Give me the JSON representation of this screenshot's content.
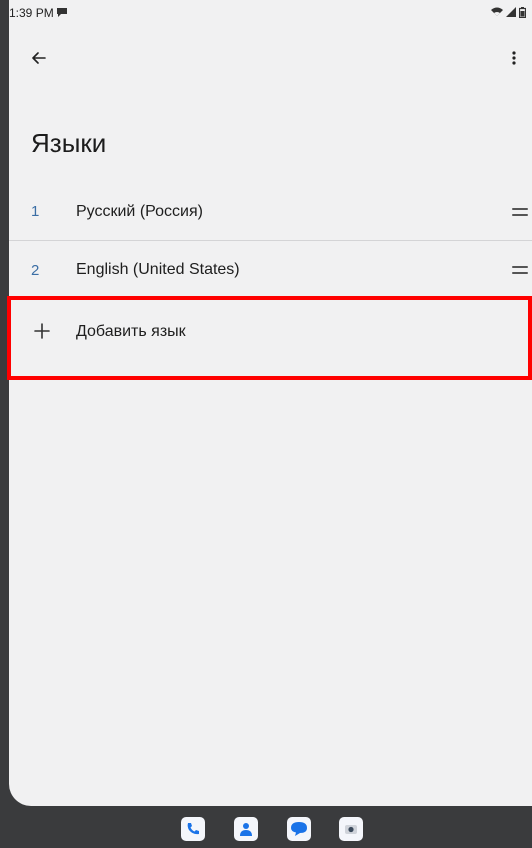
{
  "status_bar": {
    "time": "1:39 PM",
    "icons": [
      "notification-icon",
      "wifi-icon",
      "signal-icon",
      "battery-icon"
    ]
  },
  "app_bar": {
    "back_icon": "arrow-left-icon",
    "more_icon": "more-vertical-icon"
  },
  "page": {
    "title": "Языки"
  },
  "languages": [
    {
      "number": "1",
      "name": "Русский (Россия)"
    },
    {
      "number": "2",
      "name": "English (United States)"
    }
  ],
  "add_language": {
    "label": "Добавить язык",
    "icon": "plus-icon"
  },
  "dock": {
    "apps": [
      "phone-icon",
      "contacts-icon",
      "messages-icon",
      "camera-icon"
    ]
  },
  "colors": {
    "accent_number": "#3b6ea5",
    "highlight": "#ff0000",
    "dock_phone": "#1a73e8",
    "dock_contacts": "#1a73e8",
    "dock_messages": "#1a73e8"
  }
}
